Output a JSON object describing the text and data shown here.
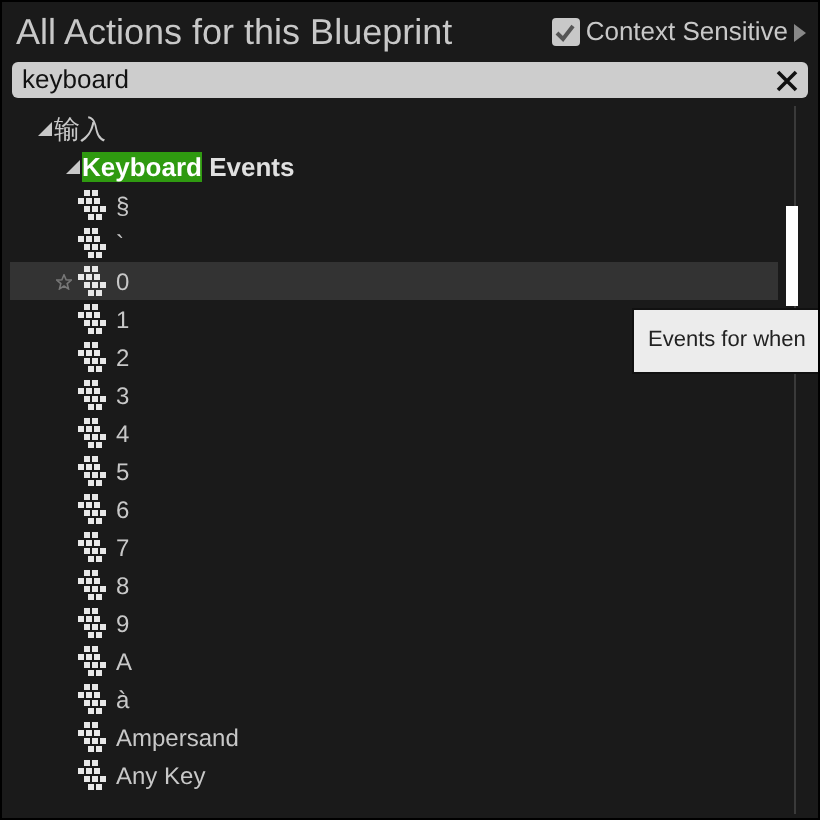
{
  "window": {
    "title": "All Actions for this Blueprint"
  },
  "context_sensitive": {
    "label": "Context Sensitive",
    "checked": true
  },
  "search": {
    "value": "keyboard"
  },
  "tree": [
    {
      "label": "输入",
      "expanded": true,
      "children": [
        {
          "label": "**Keyboard** Events",
          "expanded": true,
          "children": [
            {
              "label": "§",
              "selected": false
            },
            {
              "label": "`",
              "selected": false
            },
            {
              "label": "0",
              "selected": true
            },
            {
              "label": "1",
              "selected": false
            },
            {
              "label": "2",
              "selected": false
            },
            {
              "label": "3",
              "selected": false
            },
            {
              "label": "4",
              "selected": false
            },
            {
              "label": "5",
              "selected": false
            },
            {
              "label": "6",
              "selected": false
            },
            {
              "label": "7",
              "selected": false
            },
            {
              "label": "8",
              "selected": false
            },
            {
              "label": "9",
              "selected": false
            },
            {
              "label": "A",
              "selected": false
            },
            {
              "label": "à",
              "selected": false
            },
            {
              "label": "Ampersand",
              "selected": false
            },
            {
              "label": "Any Key",
              "selected": false
            }
          ]
        }
      ]
    }
  ],
  "tooltip": {
    "text": "Events for when"
  }
}
